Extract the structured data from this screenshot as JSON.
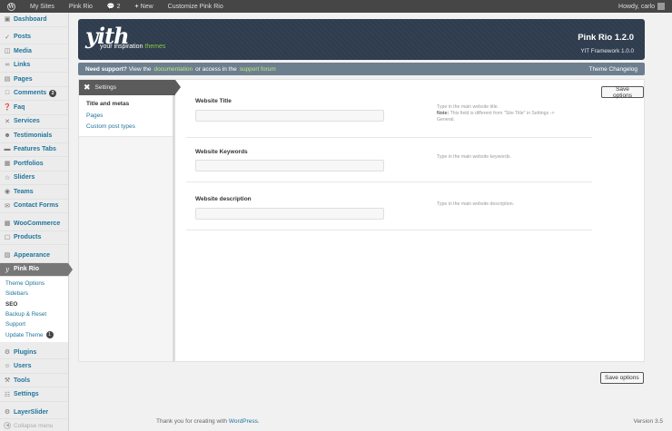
{
  "admin_bar": {
    "items": [
      "My Sites",
      "Pink Rio",
      "2",
      "New",
      "Customize Pink Rio"
    ],
    "greeting": "Howdy, carlo"
  },
  "sidebar": {
    "items": [
      {
        "label": "Dashboard",
        "icon": "dashboard-icon"
      },
      {
        "label": "Posts",
        "icon": "pin-icon"
      },
      {
        "label": "Media",
        "icon": "media-icon"
      },
      {
        "label": "Links",
        "icon": "link-icon"
      },
      {
        "label": "Pages",
        "icon": "page-icon"
      },
      {
        "label": "Comments",
        "icon": "comment-icon",
        "badge": "2"
      },
      {
        "label": "Faq",
        "icon": "question-icon"
      },
      {
        "label": "Services",
        "icon": "tools-icon"
      },
      {
        "label": "Testimonials",
        "icon": "person-icon"
      },
      {
        "label": "Features Tabs",
        "icon": "tab-icon"
      },
      {
        "label": "Portfolios",
        "icon": "folder-icon"
      },
      {
        "label": "Sliders",
        "icon": "star-icon"
      },
      {
        "label": "Teams",
        "icon": "team-icon"
      },
      {
        "label": "Contact Forms",
        "icon": "mail-icon"
      },
      {
        "label": "WooCommerce",
        "icon": "woocommerce-icon"
      },
      {
        "label": "Products",
        "icon": "product-icon"
      },
      {
        "label": "Appearance",
        "icon": "appearance-icon"
      },
      {
        "label": "Pink Rio",
        "icon": "yith-icon"
      },
      {
        "label": "Plugins",
        "icon": "plugin-icon"
      },
      {
        "label": "Users",
        "icon": "users-icon"
      },
      {
        "label": "Tools",
        "icon": "tools-icon"
      },
      {
        "label": "Settings",
        "icon": "settings-icon"
      },
      {
        "label": "LayerSlider",
        "icon": "gear-icon"
      }
    ],
    "submenu": [
      {
        "label": "Theme Options"
      },
      {
        "label": "Sidebars"
      },
      {
        "label": "SEO"
      },
      {
        "label": "Backup & Reset"
      },
      {
        "label": "Support"
      },
      {
        "label": "Update Theme",
        "badge": "1"
      }
    ],
    "collapse_label": "Collapse menu"
  },
  "banner": {
    "logo": "yith",
    "tagline_prefix": "your inspiration",
    "tagline_highlight": "themes",
    "product": "Pink Rio 1.2.0",
    "framework": "YIT Framework 1.0.0"
  },
  "support_bar": {
    "lead": "Need support?",
    "text1": "View the",
    "link1": "documentation",
    "text2": "or access in the",
    "link2": "support forum",
    "changelog": "Theme Changelog"
  },
  "panel": {
    "settings_tab": "Settings",
    "nav": [
      "Title and metas",
      "Pages",
      "Custom post types"
    ],
    "save_label": "Save options",
    "fields": [
      {
        "label": "Website Title",
        "desc": "Type in the main website title.",
        "note_label": "Note:",
        "note": "This field is different from \"Site Title\" in Settings -> General."
      },
      {
        "label": "Website Keywords",
        "desc": "Type in the main website keywords."
      },
      {
        "label": "Website description",
        "desc": "Type in the main website description."
      }
    ]
  },
  "footer": {
    "thanks": "Thank you for creating with",
    "link": "WordPress.",
    "version": "Version 3.5"
  },
  "colors": {
    "link": "#21759b",
    "banner_bg": "#2e3c4e",
    "accent_green": "#8cc63f",
    "admin_bar": "#464646"
  }
}
